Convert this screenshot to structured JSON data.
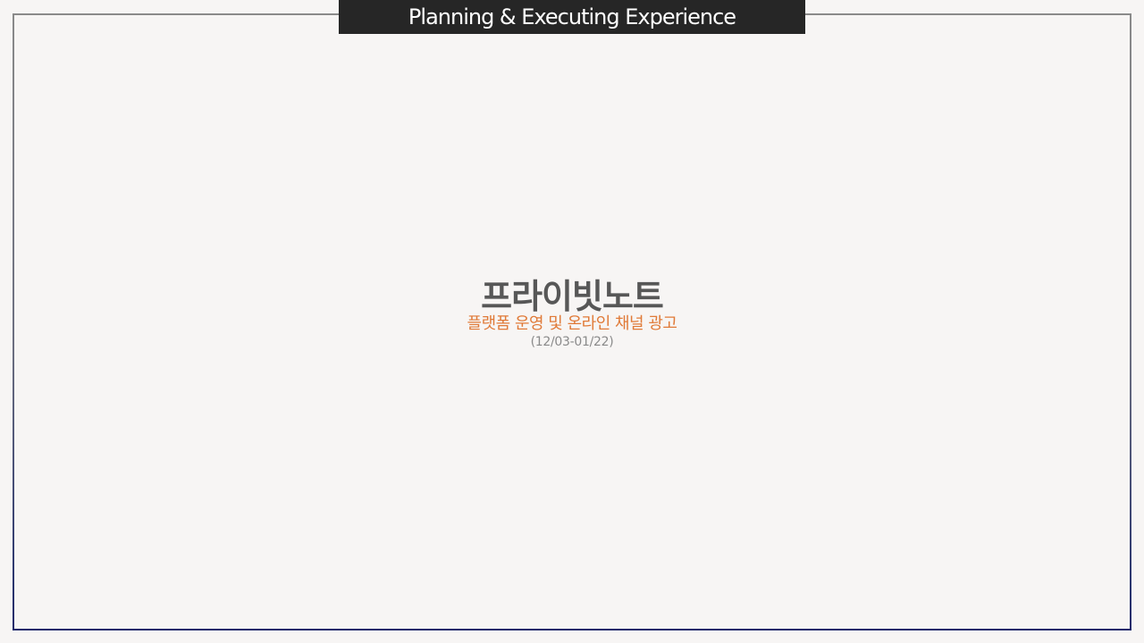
{
  "header": {
    "title": "Planning & Executing Experience"
  },
  "main": {
    "title": "프라이빗노트",
    "subtitle": "플랫폼 운영 및 온라인 채널 광고",
    "date_range": "(12/03-01/22)"
  },
  "colors": {
    "background": "#f7f5f4",
    "header_bar": "#262626",
    "title": "#575757",
    "subtitle_accent": "#e07a38",
    "date_text": "#8a8a8a",
    "frame_bottom": "#1e2a6b"
  }
}
